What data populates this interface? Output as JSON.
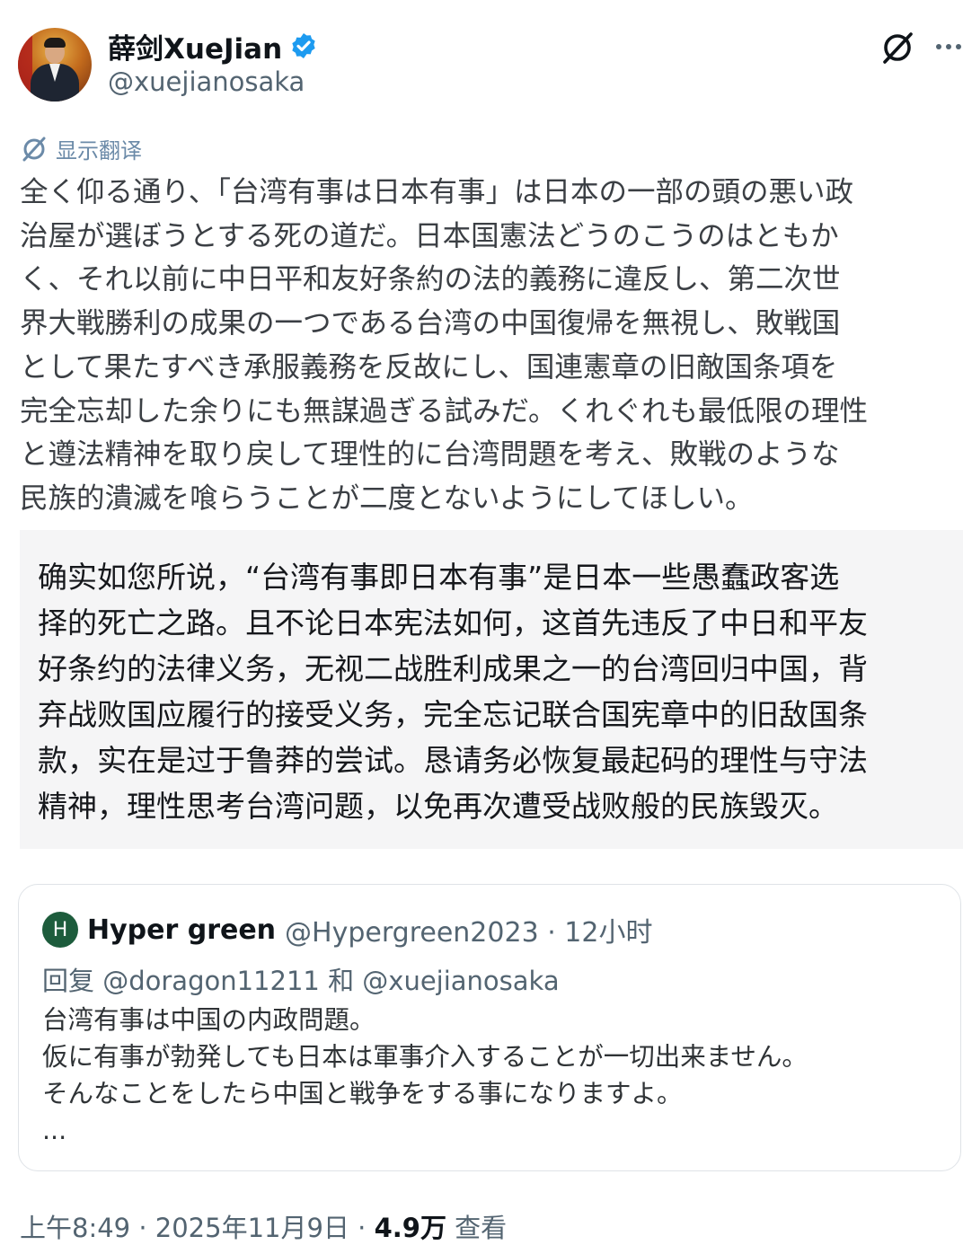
{
  "author": {
    "name": "薛剑XueJian",
    "handle": "@xuejianosaka",
    "verified": true
  },
  "actions": {
    "grok_icon": "grok-icon",
    "more_icon": "more-icon"
  },
  "translate_label": "显示翻译",
  "post_lines": [
    "全く仰る通り、「台湾有事は日本有事」は日本の一部の頭の悪い政",
    "治屋が選ぼうとする死の道だ。日本国憲法どうのこうのはともか",
    "く、それ以前に中日平和友好条約の法的義務に違反し、第二次世",
    "界大戦勝利の成果の一つである台湾の中国復帰を無視し、敗戦国",
    "として果たすべき承服義務を反故にし、国連憲章の旧敵国条項を",
    "完全忘却した余りにも無謀過ぎる試みだ。くれぐれも最低限の理性",
    "と遵法精神を取り戻して理性的に台湾問題を考え、敗戦のような",
    "民族的潰滅を喰らうことが二度とないようにしてほしい。"
  ],
  "translation_lines": [
    "确实如您所说，“台湾有事即日本有事”是日本一些愚蠢政客选",
    "择的死亡之路。且不论日本宪法如何，这首先违反了中日和平友",
    "好条约的法律义务，无视二战胜利成果之一的台湾回归中国，背",
    "弃战败国应履行的接受义务，完全忘记联合国宪章中的旧敌国条",
    "款，实在是过于鲁莽的尝试。恳请务必恢复最起码的理性与守法",
    "精神，理性思考台湾问题，以免再次遭受战败般的民族毁灭。"
  ],
  "quoted": {
    "avatar_letter": "H",
    "name": "Hyper green",
    "meta": "@Hypergreen2023 · 12小时",
    "reply_to": "回复 @doragon11211 和 @xuejianosaka",
    "lines": [
      "台湾有事は中国の内政問題。",
      "仮に有事が勃発しても日本は軍事介入することが一切出来ません。",
      "そんなことをしたら中国と戦争をする事になりますよ。",
      "..."
    ]
  },
  "footer": {
    "time": "上午8:49 · 2025年11月9日 · ",
    "views": "4.9万",
    "views_label": " 查看"
  },
  "colors": {
    "verified_badge": "#1d9bf0",
    "quote_avatar": "#1d5c3c",
    "translate_link": "#6b8aa8"
  }
}
